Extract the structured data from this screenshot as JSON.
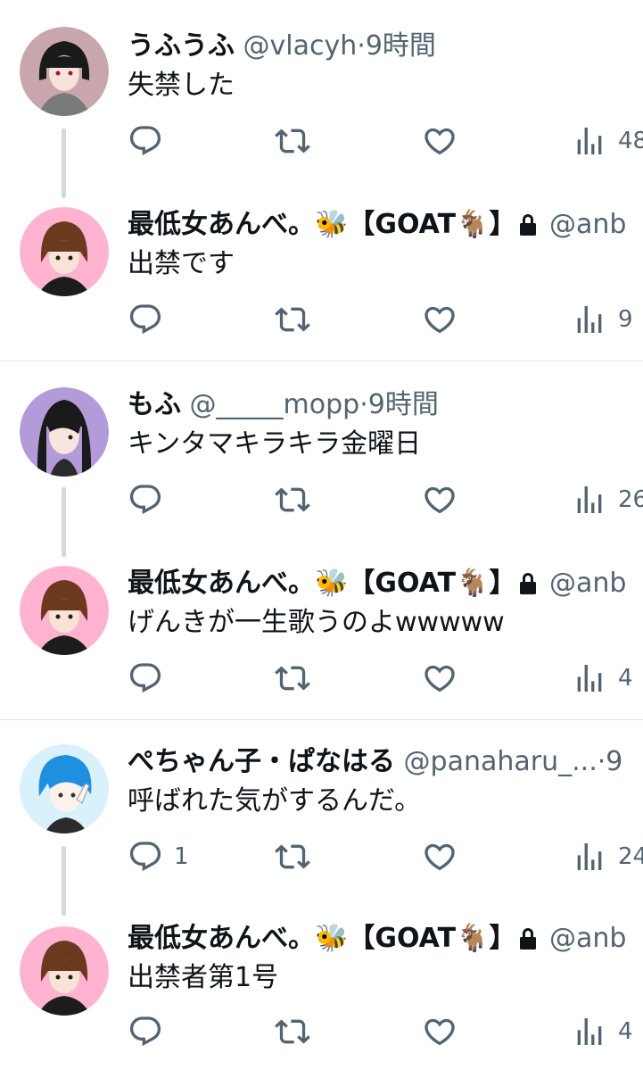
{
  "groups": [
    {
      "parent": {
        "name": "うふうふ",
        "handle": "@vlacyh",
        "sep": "·",
        "time": "9時間",
        "text": "失禁した",
        "reply_count": "",
        "views": "48"
      },
      "reply": {
        "name": "最低女あんべ。🐝【GOAT🐐】",
        "handle": "@anb",
        "text": "出禁です",
        "reply_count": "",
        "views": "9"
      }
    },
    {
      "parent": {
        "name": "もふ",
        "handle": "@_____mopp",
        "sep": "·",
        "time": "9時間",
        "text": "キンタマキラキラ金曜日",
        "reply_count": "",
        "views": "26"
      },
      "reply": {
        "name": "最低女あんべ。🐝【GOAT🐐】",
        "handle": "@anb",
        "text": "げんきが一生歌うのよwwwww",
        "reply_count": "",
        "views": "4"
      }
    },
    {
      "parent": {
        "name": "ぺちゃん子・ぱなはる",
        "handle": "@panaharu_...",
        "sep": "·",
        "time": "9",
        "text": "呼ばれた気がするんだ。",
        "reply_count": "1",
        "views": "24"
      },
      "reply": {
        "name": "最低女あんべ。🐝【GOAT🐐】",
        "handle": "@anb",
        "text": "出禁者第1号",
        "reply_count": "",
        "views": "4"
      }
    }
  ],
  "colors": {
    "text": "#0f1419",
    "secondary": "#536471",
    "thread_line": "#cfd9de",
    "divider": "#e1e6ea"
  },
  "icons": [
    "reply-icon",
    "retweet-icon",
    "like-icon",
    "views-icon",
    "lock-icon"
  ]
}
